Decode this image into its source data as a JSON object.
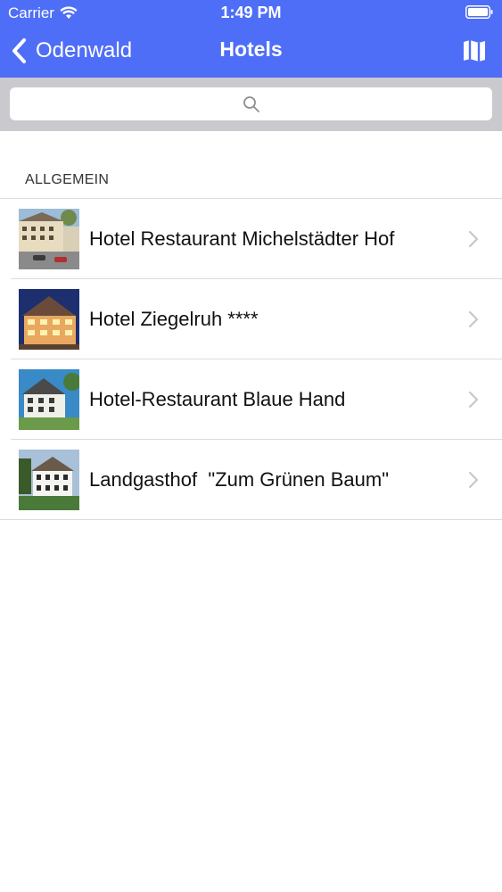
{
  "status_bar": {
    "carrier": "Carrier",
    "time": "1:49 PM",
    "icons": [
      "wifi-icon",
      "battery-icon"
    ]
  },
  "nav": {
    "back_label": "Odenwald",
    "title": "Hotels",
    "right_icon": "map-icon",
    "color": "#4f6ef7"
  },
  "search": {
    "placeholder": "",
    "icon": "search-icon"
  },
  "section": {
    "header": "ALLGEMEIN",
    "items": [
      {
        "title": "Hotel Restaurant Michelstädter Hof",
        "thumb": "hotel-photo"
      },
      {
        "title": "Hotel Ziegelruh ****",
        "thumb": "hotel-photo"
      },
      {
        "title": "Hotel-Restaurant Blaue Hand",
        "thumb": "hotel-photo"
      },
      {
        "title": "Landgasthof  \"Zum Grünen Baum\"",
        "thumb": "hotel-photo"
      }
    ]
  }
}
